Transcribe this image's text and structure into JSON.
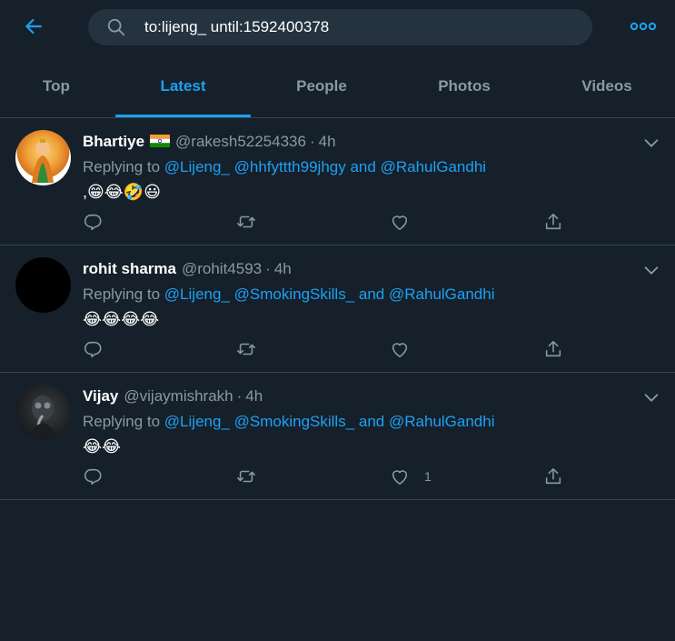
{
  "search": {
    "query": "to:lijeng_ until:1592400378"
  },
  "tabs": [
    {
      "label": "Top",
      "active": false
    },
    {
      "label": "Latest",
      "active": true
    },
    {
      "label": "People",
      "active": false
    },
    {
      "label": "Photos",
      "active": false
    },
    {
      "label": "Videos",
      "active": false
    }
  ],
  "colors": {
    "accent": "#1da1f2",
    "background": "#15202b",
    "muted": "#8899a6",
    "divider": "#38444d"
  },
  "tweets": [
    {
      "name": "Bhartiye",
      "has_flag": true,
      "handle": "@rakesh52254336",
      "dot": "·",
      "time": "4h",
      "replying_prefix": "Replying to",
      "mention1": "@Lijeng_",
      "mention2": "@hhfyttth99jhgy",
      "and": "and",
      "mention3": "@RahulGandhi",
      "text": ",😁😂🤣😃",
      "like_count": ""
    },
    {
      "name": "rohit sharma",
      "has_flag": false,
      "handle": "@rohit4593",
      "dot": "·",
      "time": "4h",
      "replying_prefix": "Replying to",
      "mention1": "@Lijeng_",
      "mention2": "@SmokingSkills_",
      "and": "and",
      "mention3": "@RahulGandhi",
      "text": "😂😂😂😂",
      "like_count": ""
    },
    {
      "name": "Vijay",
      "has_flag": false,
      "handle": "@vijaymishrakh",
      "dot": "·",
      "time": "4h",
      "replying_prefix": "Replying to",
      "mention1": "@Lijeng_",
      "mention2": "@SmokingSkills_",
      "and": "and",
      "mention3": "@RahulGandhi",
      "text": "😂😂",
      "like_count": "1"
    }
  ]
}
